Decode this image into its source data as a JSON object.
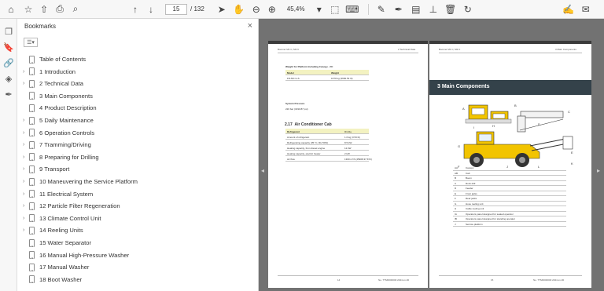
{
  "toolbar": {
    "current_page": "15",
    "page_total": "/ 132",
    "zoom": "45,4%"
  },
  "bookmarks": {
    "title": "Bookmarks",
    "items": [
      {
        "label": "Table of Contents",
        "expandable": false
      },
      {
        "label": "1 Introduction",
        "expandable": true
      },
      {
        "label": "2 Technical Data",
        "expandable": true
      },
      {
        "label": "3 Main Components",
        "expandable": false
      },
      {
        "label": "4 Product Description",
        "expandable": false
      },
      {
        "label": "5 Daily Maintenance",
        "expandable": true
      },
      {
        "label": "6 Operation Controls",
        "expandable": true
      },
      {
        "label": "7 Tramming/Driving",
        "expandable": true
      },
      {
        "label": "8 Preparing for Drilling",
        "expandable": true
      },
      {
        "label": "9 Transport",
        "expandable": true
      },
      {
        "label": "10 Maneuvering the Service Platform",
        "expandable": true
      },
      {
        "label": "11 Electrical System",
        "expandable": true
      },
      {
        "label": "12 Particle Filter Regeneration",
        "expandable": true
      },
      {
        "label": "13 Climate Control Unit",
        "expandable": true
      },
      {
        "label": "14 Reeling Units",
        "expandable": true
      },
      {
        "label": "15 Water Separator",
        "expandable": false
      },
      {
        "label": "16 Manual High-Pressure Washer",
        "expandable": false
      },
      {
        "label": "17 Manual Washer",
        "expandable": false
      },
      {
        "label": "18 Boot Washer",
        "expandable": false
      }
    ]
  },
  "page_left": {
    "header_left": "Boomer M1 C, M2 C",
    "header_right": "2 Technical Data",
    "weight_title": "Weight for Platform Including Canopy - FC",
    "weight_table": {
      "headers": [
        "Model",
        "Weight"
      ],
      "rows": [
        [
          "FD-MC H-S",
          "1670 kg (3682.53 lb)"
        ]
      ]
    },
    "pressure_title": "System Pressure",
    "pressure_value": "220 bar (3190.87 psi)",
    "section_number": "2.17",
    "section_name": "Air Conditioner Cab",
    "ac_table": {
      "headers": [
        "Refrigerant",
        "R134a"
      ],
      "rows": [
        [
          "Amount of refrigerant",
          "1.6 kg (3.53 lb)"
        ],
        [
          "Refrigerating capacity (35 °C, RH 50%)",
          "8.5 kW"
        ],
        [
          "Heating capacity, from diesel engine",
          "12 kW"
        ],
        [
          "Heating capacity, electric heater",
          "2 kW"
        ],
        [
          "Air flow",
          "1300 m³/h (45908.37 ft³/h)"
        ]
      ]
    },
    "footer_page": "14",
    "footer_doc": "No. TTM0000000 2024-xx-00"
  },
  "page_right": {
    "header_left": "Boomer M1 C, M2 C",
    "header_right": "3 Main Components",
    "band_title": "3  Main Components",
    "figure_letters": [
      "A",
      "B",
      "C",
      "D",
      "E",
      "F",
      "G",
      "H",
      "I",
      "J",
      "K",
      "L"
    ],
    "components": [
      [
        "AA",
        "Canopy"
      ],
      [
        "AB",
        "Cab"
      ],
      [
        "B",
        "Boom"
      ],
      [
        "C",
        "Rock drill"
      ],
      [
        "D",
        "Feeder"
      ],
      [
        "E",
        "Front jacks"
      ],
      [
        "F",
        "Rear jacks"
      ],
      [
        "G",
        "Hose reeling unit"
      ],
      [
        "H",
        "Cable reeling unit"
      ],
      [
        "IA",
        "Operators panel designed for seated operator"
      ],
      [
        "IB",
        "Operators panel designed for standing operator"
      ],
      [
        "J",
        "Service platform"
      ]
    ],
    "footer_page": "15",
    "footer_doc": "No. TTM0000000 2024-xx-00"
  },
  "colors": {
    "accent": "#1473e6",
    "viewer_bg": "#727272",
    "band_bg": "#34424a",
    "band_text": "#ffffff",
    "table_head": "#f3f2c1",
    "machine_yellow": "#f2c400"
  }
}
